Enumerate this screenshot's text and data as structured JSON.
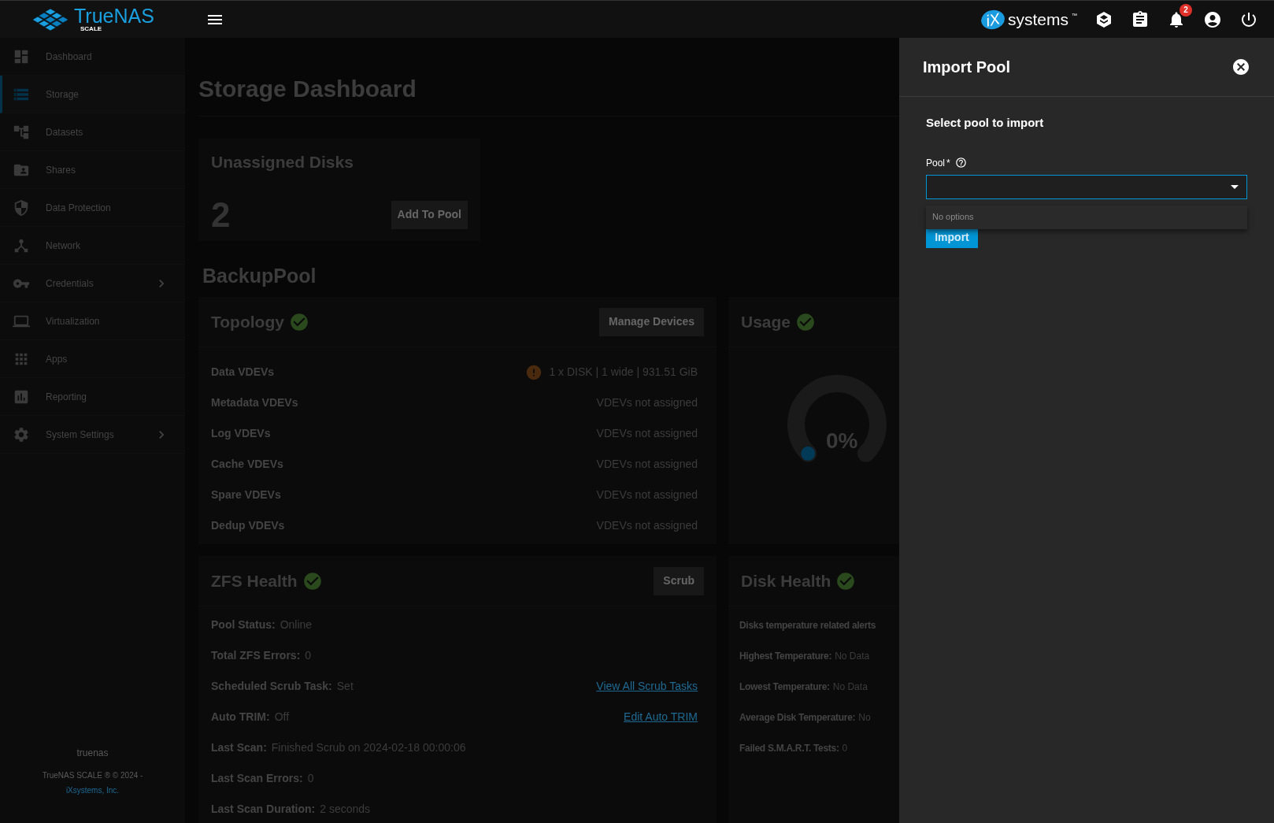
{
  "topbar": {
    "logo_text": "TrueNAS",
    "logo_subtext": "SCALE",
    "brand_mark": "iX",
    "brand_text": "systems",
    "brand_tm": "™",
    "notification_count": "2"
  },
  "sidebar": {
    "items": [
      {
        "label": "Dashboard",
        "selected": false,
        "expandable": false
      },
      {
        "label": "Storage",
        "selected": true,
        "expandable": false
      },
      {
        "label": "Datasets",
        "selected": false,
        "expandable": false
      },
      {
        "label": "Shares",
        "selected": false,
        "expandable": false
      },
      {
        "label": "Data Protection",
        "selected": false,
        "expandable": false
      },
      {
        "label": "Network",
        "selected": false,
        "expandable": false
      },
      {
        "label": "Credentials",
        "selected": false,
        "expandable": true
      },
      {
        "label": "Virtualization",
        "selected": false,
        "expandable": false
      },
      {
        "label": "Apps",
        "selected": false,
        "expandable": false
      },
      {
        "label": "Reporting",
        "selected": false,
        "expandable": false
      },
      {
        "label": "System Settings",
        "selected": false,
        "expandable": true
      }
    ],
    "hostname": "truenas",
    "copyright": "TrueNAS SCALE ® © 2024 -",
    "company_link": "iXsystems, Inc."
  },
  "page": {
    "title": "Storage Dashboard",
    "unassigned": {
      "title": "Unassigned Disks",
      "count": "2",
      "button": "Add To Pool"
    },
    "pool_name": "BackupPool",
    "topology": {
      "title": "Topology",
      "healthy": true,
      "button": "Manage Devices",
      "rows": [
        {
          "label": "Data VDEVs",
          "value": "1 x DISK | 1 wide | 931.51 GiB",
          "warning": true
        },
        {
          "label": "Metadata VDEVs",
          "value": "VDEVs not assigned",
          "warning": false
        },
        {
          "label": "Log VDEVs",
          "value": "VDEVs not assigned",
          "warning": false
        },
        {
          "label": "Cache VDEVs",
          "value": "VDEVs not assigned",
          "warning": false
        },
        {
          "label": "Spare VDEVs",
          "value": "VDEVs not assigned",
          "warning": false
        },
        {
          "label": "Dedup VDEVs",
          "value": "VDEVs not assigned",
          "warning": false
        }
      ]
    },
    "usage": {
      "title": "Usage",
      "healthy": true,
      "reading": "0%"
    },
    "zfs_health": {
      "title": "ZFS Health",
      "healthy": true,
      "button": "Scrub",
      "rows": [
        {
          "label": "Pool Status:",
          "value": "Online"
        },
        {
          "label": "Total ZFS Errors:",
          "value": "0"
        },
        {
          "label": "Scheduled Scrub Task:",
          "value": "Set",
          "link": "View All Scrub Tasks"
        },
        {
          "label": "Auto TRIM:",
          "value": "Off",
          "link": "Edit Auto TRIM"
        },
        {
          "label": "Last Scan:",
          "value": "Finished Scrub on 2024-02-18 00:00:06"
        },
        {
          "label": "Last Scan Errors:",
          "value": "0"
        },
        {
          "label": "Last Scan Duration:",
          "value": "2 seconds"
        }
      ]
    },
    "disk_health": {
      "title": "Disk Health",
      "healthy": true,
      "rows": [
        {
          "label": "Disks temperature related alerts"
        },
        {
          "label": "Highest Temperature:",
          "value": "No Data"
        },
        {
          "label": "Lowest Temperature:",
          "value": "No Data"
        },
        {
          "label": "Average Disk Temperature:",
          "value": "No"
        },
        {
          "label": "Failed S.M.A.R.T. Tests:",
          "value": "0"
        }
      ]
    }
  },
  "drawer": {
    "title": "Import Pool",
    "subtitle": "Select pool to import",
    "field_label": "Pool",
    "required_mark": "*",
    "dropdown_message": "No options",
    "button": "Import"
  }
}
